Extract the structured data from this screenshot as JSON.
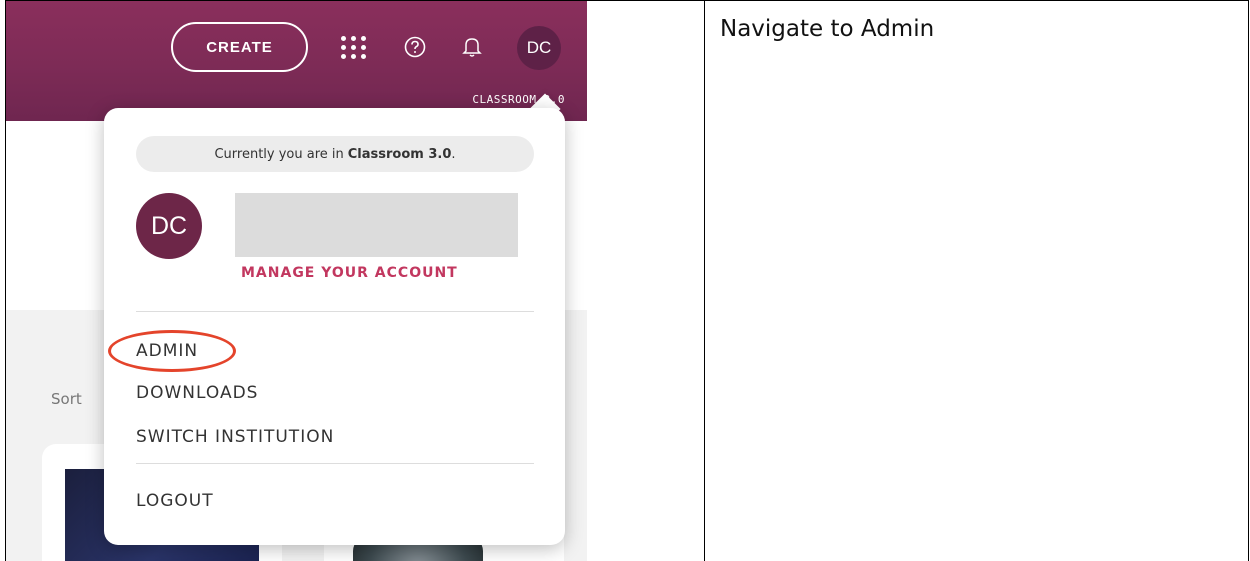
{
  "header": {
    "create_label": "CREATE",
    "avatar_initials": "DC",
    "institution": "CLASSROOM 3.0",
    "brand_color": "#7d2b56"
  },
  "dropdown": {
    "current_prefix": "Currently you are in",
    "current_institution": "Classroom 3.0",
    "current_suffix": ".",
    "avatar_initials": "DC",
    "manage_account_label": "MANAGE YOUR ACCOUNT",
    "menu_items": [
      "ADMIN",
      "DOWNLOADS",
      "SWITCH INSTITUTION"
    ],
    "logout_label": "LOGOUT",
    "highlight_color": "#e4442b"
  },
  "page": {
    "sort_label": "Sort"
  },
  "instruction": {
    "text": "Navigate to Admin"
  },
  "icons": {
    "apps": "apps-grid-icon",
    "help": "help-circle-icon",
    "notifications": "bell-icon"
  }
}
